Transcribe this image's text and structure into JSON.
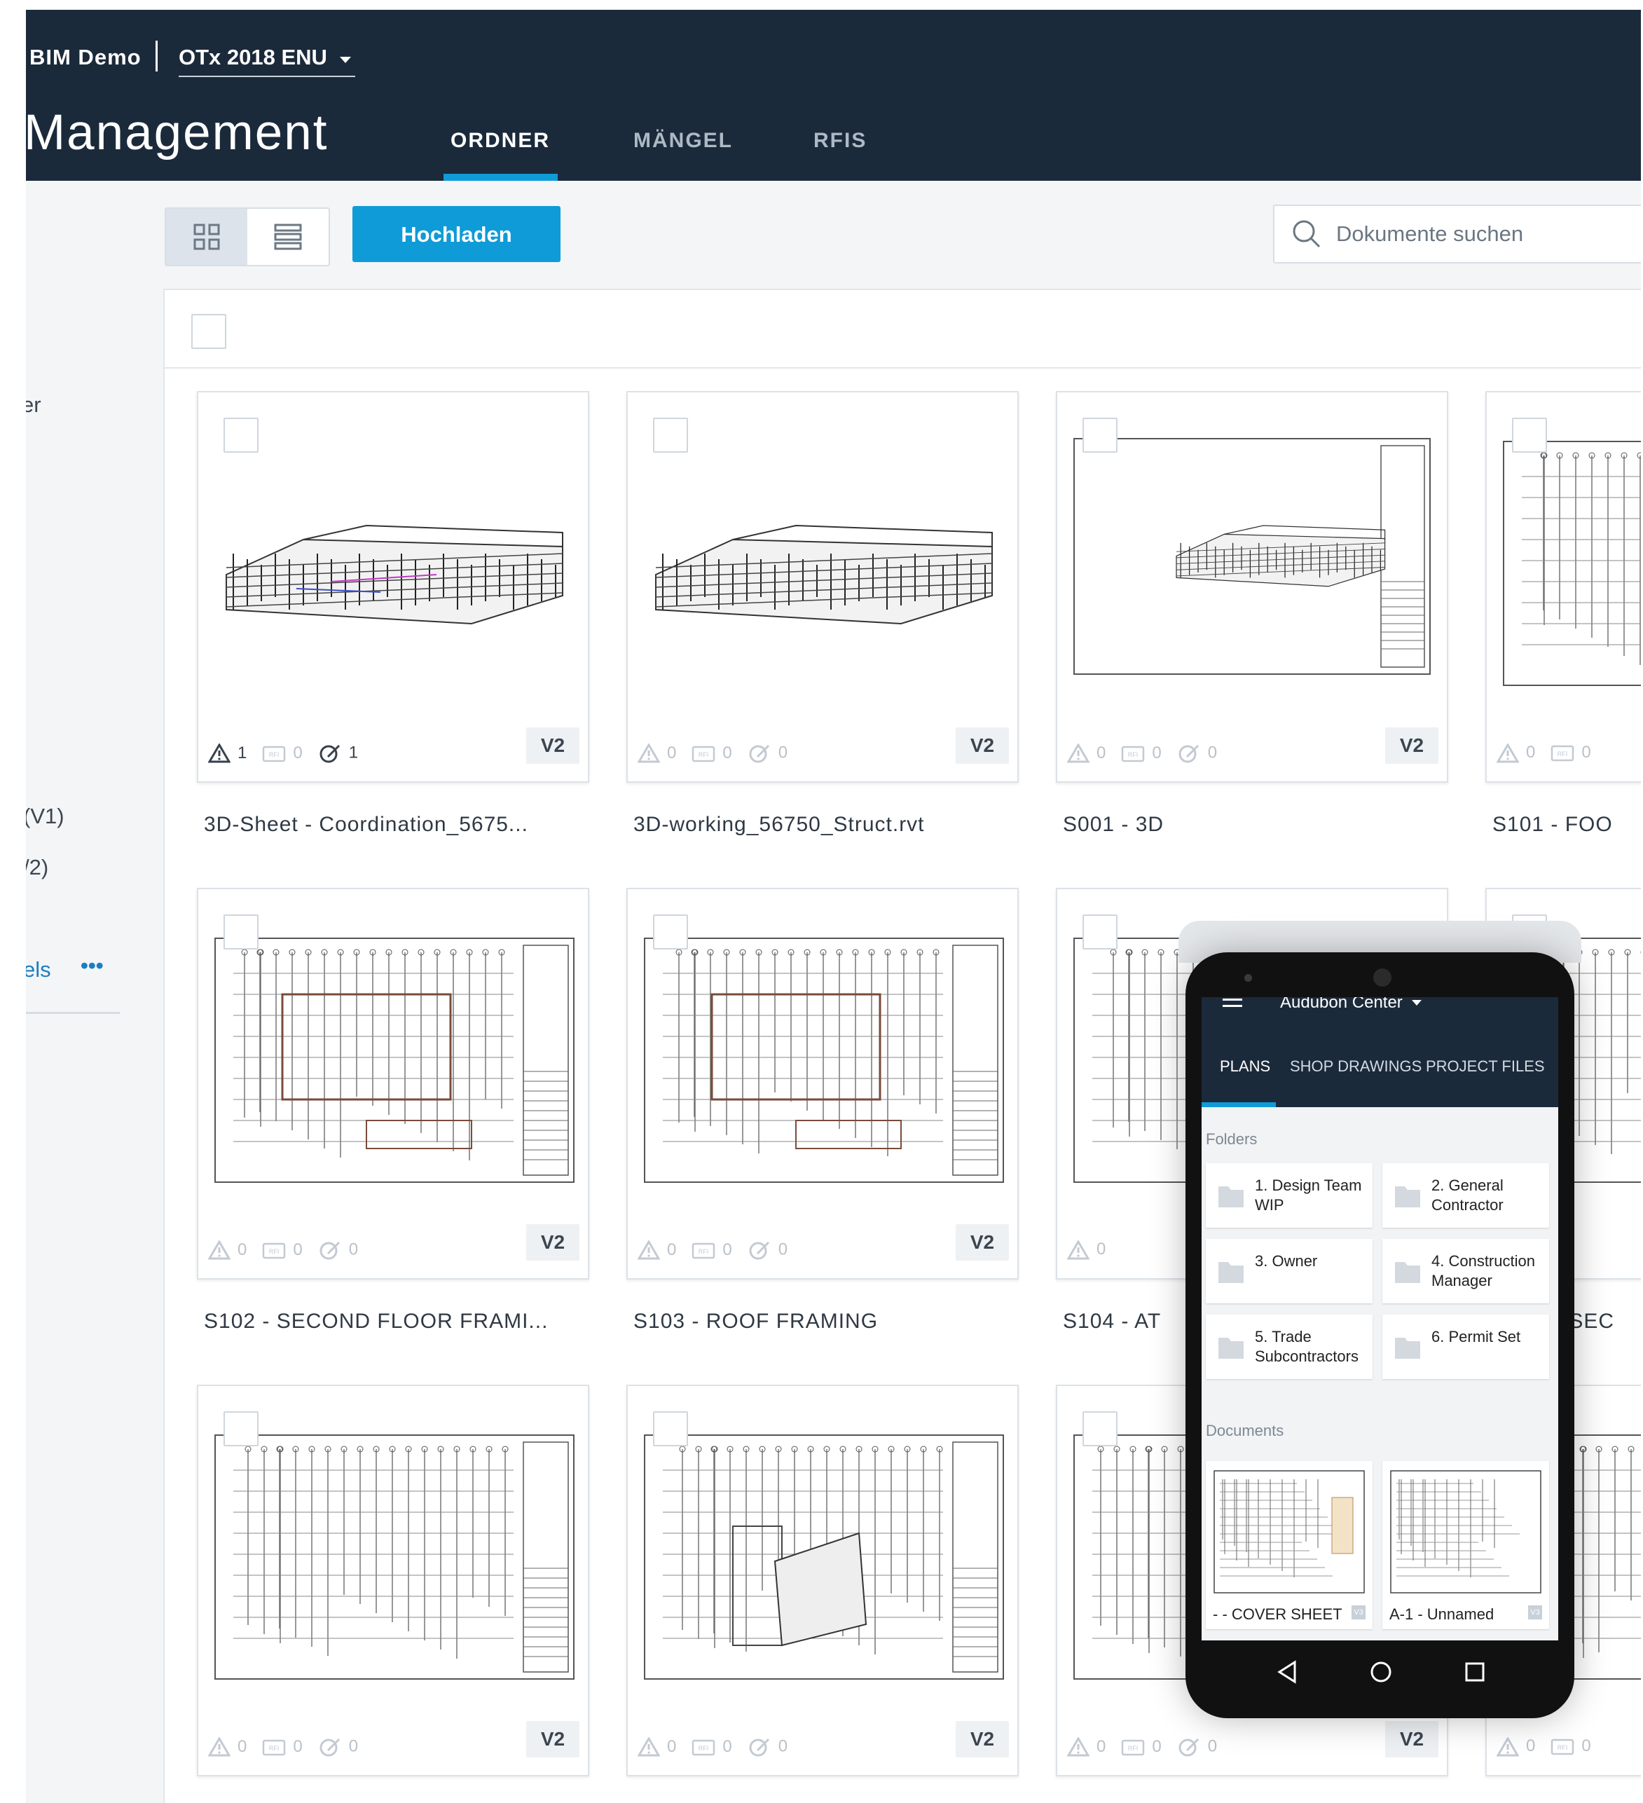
{
  "header": {
    "account": "BIM Demo",
    "project": "OTx 2018 ENU",
    "title": "Management",
    "tabs": [
      {
        "label": "ORDNER",
        "active": true
      },
      {
        "label": "MÄNGEL",
        "active": false
      },
      {
        "label": "RFIS",
        "active": false
      }
    ]
  },
  "sidebar": {
    "fragments": [
      "er",
      "(V1)",
      "/2)",
      "els"
    ],
    "more_label": "•••"
  },
  "toolbar": {
    "upload_label": "Hochladen",
    "search_placeholder": "Dokumente suchen"
  },
  "cards": [
    {
      "title": "3D-Sheet - Coordination_5675...",
      "issues": "1",
      "rfis": "0",
      "markups": "1",
      "version": "V2"
    },
    {
      "title": "3D-working_56750_Struct.rvt",
      "issues": "0",
      "rfis": "0",
      "markups": "0",
      "version": "V2"
    },
    {
      "title": "S001 - 3D",
      "issues": "0",
      "rfis": "0",
      "markups": "0",
      "version": "V2"
    },
    {
      "title": "S101 - FOO",
      "issues": "0",
      "rfis": "0",
      "markups": "",
      "version": ""
    },
    {
      "title": "S102 - SECOND FLOOR FRAMI...",
      "issues": "0",
      "rfis": "0",
      "markups": "0",
      "version": "V2"
    },
    {
      "title": "S103 - ROOF FRAMING",
      "issues": "0",
      "rfis": "0",
      "markups": "0",
      "version": "V2"
    },
    {
      "title": "S104 - AT",
      "issues": "0",
      "rfis": "",
      "markups": "",
      "version": ""
    },
    {
      "title": "- SEC",
      "issues": "",
      "rfis": "",
      "markups": "",
      "version": ""
    },
    {
      "title": "",
      "issues": "0",
      "rfis": "0",
      "markups": "0",
      "version": "V2"
    },
    {
      "title": "",
      "issues": "0",
      "rfis": "0",
      "markups": "0",
      "version": "V2"
    },
    {
      "title": "",
      "issues": "0",
      "rfis": "0",
      "markups": "0",
      "version": "V2"
    },
    {
      "title": "",
      "issues": "0",
      "rfis": "0",
      "markups": "",
      "version": ""
    }
  ],
  "mobile": {
    "project": "Audubon Center",
    "tabs": [
      {
        "label": "PLANS",
        "active": true
      },
      {
        "label": "SHOP DRAWINGS",
        "active": false
      },
      {
        "label": "PROJECT FILES",
        "active": false
      }
    ],
    "folders_heading": "Folders",
    "folders": [
      {
        "label": "1. Design Team WIP"
      },
      {
        "label": "2. General Contractor"
      },
      {
        "label": "3. Owner"
      },
      {
        "label": "4. Construction Manager"
      },
      {
        "label": "5. Trade Subcontractors"
      },
      {
        "label": "6. Permit Set"
      }
    ],
    "documents_heading": "Documents",
    "documents": [
      {
        "label": "- - COVER SHEET",
        "version": "V3"
      },
      {
        "label": "A-1 - Unnamed",
        "version": "V3"
      }
    ]
  },
  "colors": {
    "header_bg": "#1b2a3b",
    "accent": "#0f9bd7",
    "panel_bg": "#f3f5f7"
  },
  "icons": [
    "grid-view-icon",
    "list-view-icon",
    "search-icon",
    "issue-warning-icon",
    "rfi-icon",
    "markup-icon",
    "hamburger-icon",
    "folder-icon",
    "back-icon",
    "home-icon",
    "recent-apps-icon"
  ]
}
